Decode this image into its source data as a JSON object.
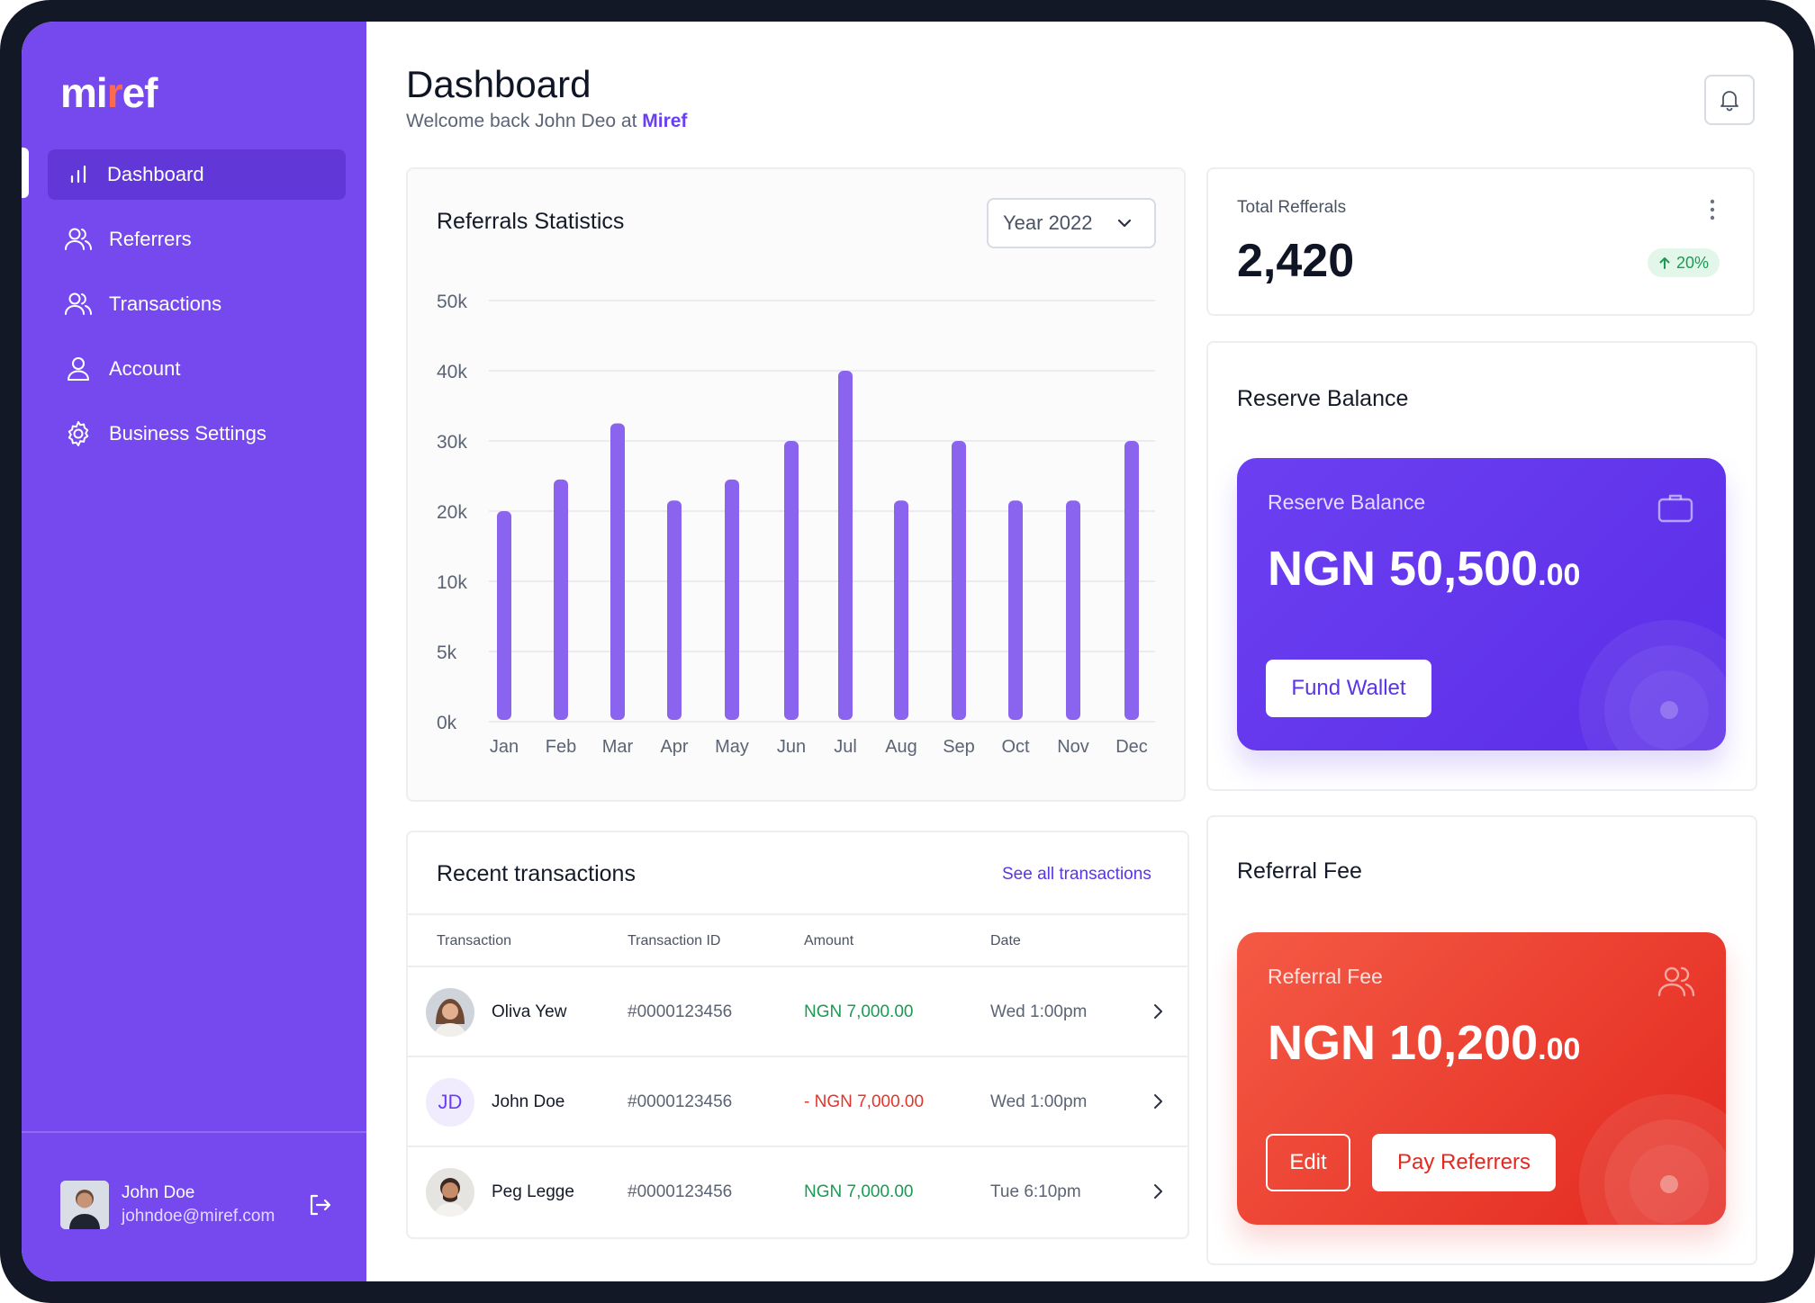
{
  "app": {
    "logo_prefix": "mi",
    "logo_accent": "r",
    "logo_suffix": "ef"
  },
  "sidebar": {
    "items": [
      {
        "label": "Dashboard",
        "icon": "bar-chart-icon",
        "active": true
      },
      {
        "label": "Referrers",
        "icon": "users-icon"
      },
      {
        "label": "Transactions",
        "icon": "users-icon"
      },
      {
        "label": "Account",
        "icon": "user-icon"
      },
      {
        "label": "Business Settings",
        "icon": "gear-icon"
      }
    ],
    "user": {
      "name": "John Doe",
      "email": "johndoe@miref.com"
    }
  },
  "header": {
    "title": "Dashboard",
    "subtitle_prefix": "Welcome back John Deo at ",
    "subtitle_brand": "Miref"
  },
  "chart_card": {
    "title": "Referrals Statistics",
    "year_select": "Year 2022"
  },
  "chart_data": {
    "type": "bar",
    "categories": [
      "Jan",
      "Feb",
      "Mar",
      "Apr",
      "May",
      "Jun",
      "Jul",
      "Aug",
      "Sep",
      "Oct",
      "Nov",
      "Dec"
    ],
    "values": [
      20000,
      24500,
      32500,
      21500,
      24500,
      30000,
      40000,
      21500,
      30000,
      21500,
      21500,
      30000
    ],
    "y_ticks": [
      {
        "value": 0,
        "label": "0k"
      },
      {
        "value": 5000,
        "label": "5k"
      },
      {
        "value": 10000,
        "label": "10k"
      },
      {
        "value": 20000,
        "label": "20k"
      },
      {
        "value": 30000,
        "label": "30k"
      },
      {
        "value": 40000,
        "label": "40k"
      },
      {
        "value": 50000,
        "label": "50k"
      }
    ],
    "grid": true,
    "bar_color": "#8a63ef"
  },
  "transactions": {
    "title": "Recent transactions",
    "see_all": "See all transactions",
    "columns": [
      "Transaction",
      "Transaction ID",
      "Amount",
      "Date"
    ],
    "rows": [
      {
        "name": "Oliva Yew",
        "id": "#0000123456",
        "amount": "NGN 7,000.00",
        "date": "Wed 1:00pm",
        "avatar": "photo",
        "kind": "pos"
      },
      {
        "name": "John Doe",
        "id": "#0000123456",
        "amount": "- NGN 7,000.00",
        "date": "Wed 1:00pm",
        "avatar": "JD",
        "kind": "neg"
      },
      {
        "name": "Peg Legge",
        "id": "#0000123456",
        "amount": "NGN 7,000.00",
        "date": "Tue 6:10pm",
        "avatar": "photo",
        "kind": "pos"
      }
    ]
  },
  "total_referrals": {
    "label": "Total Refferals",
    "value": "2,420",
    "change": "20%"
  },
  "reserve_balance": {
    "title": "Reserve Balance",
    "card_label": "Reserve Balance",
    "amount_main": "NGN 50,500",
    "amount_cents": ".00",
    "button": "Fund Wallet"
  },
  "referral_fee": {
    "title": "Referral Fee",
    "card_label": "Referral Fee",
    "amount_main": "NGN 10,200",
    "amount_cents": ".00",
    "edit_button": "Edit",
    "pay_button": "Pay Referrers"
  },
  "colors": {
    "primary": "#7549ee",
    "positive": "#1a9a53",
    "negative": "#e1362c",
    "danger": "#e3281f"
  }
}
